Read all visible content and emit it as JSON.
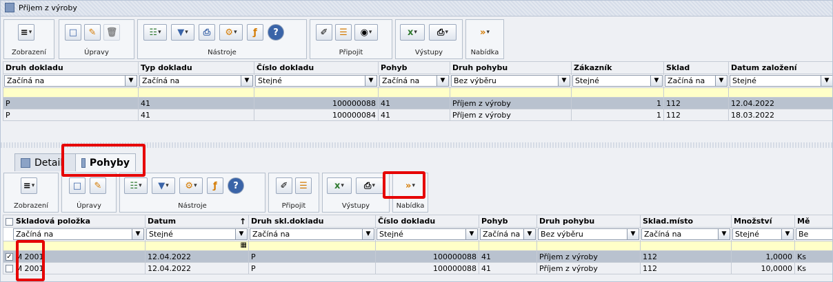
{
  "window": {
    "title": "Příjem z výroby"
  },
  "top_toolbar": {
    "groups": [
      {
        "caption": "Zobrazení"
      },
      {
        "caption": "Úpravy"
      },
      {
        "caption": "Nástroje"
      },
      {
        "caption": "Připojit"
      },
      {
        "caption": "Výstupy"
      },
      {
        "caption": "Nabídka"
      }
    ]
  },
  "top_grid": {
    "columns": [
      "Druh dokladu",
      "Typ dokladu",
      "Číslo dokladu",
      "Pohyb",
      "Druh pohybu",
      "Zákazník",
      "Sklad",
      "Datum založení"
    ],
    "filters": [
      "Začíná na",
      "Začíná na",
      "Stejné",
      "Začíná na",
      "Bez výběru",
      "Stejné",
      "Začíná na",
      "Stejné"
    ],
    "rows": [
      [
        "P",
        "41",
        "100000088",
        "41",
        "Příjem z výroby",
        "1",
        "112",
        "12.04.2022"
      ],
      [
        "P",
        "41",
        "100000084",
        "41",
        "Příjem z výroby",
        "1",
        "112",
        "18.03.2022"
      ]
    ]
  },
  "tabs": {
    "detail": "Detail",
    "pohyby": "Pohyby"
  },
  "bottom_toolbar": {
    "groups": [
      {
        "caption": "Zobrazení"
      },
      {
        "caption": "Úpravy"
      },
      {
        "caption": "Nástroje"
      },
      {
        "caption": "Připojit"
      },
      {
        "caption": "Výstupy"
      },
      {
        "caption": "Nabídka"
      }
    ]
  },
  "bottom_grid": {
    "columns": [
      "Skladová položka",
      "Datum",
      "Druh skl.dokladu",
      "Číslo dokladu",
      "Pohyb",
      "Druh pohybu",
      "Sklad.místo",
      "Množství",
      "Mě"
    ],
    "filters": [
      "Začíná na",
      "Stejné",
      "Začíná na",
      "Stejné",
      "Začíná na",
      "Bez výběru",
      "Začíná na",
      "Stejné",
      "Be"
    ],
    "rows": [
      {
        "checked": "✓",
        "cells": [
          "M 2001",
          "12.04.2022",
          "P",
          "100000088",
          "41",
          "Příjem z výroby",
          "112",
          "1,0000",
          "Ks"
        ]
      },
      {
        "checked": "",
        "cells": [
          "M 2001",
          "12.04.2022",
          "P",
          "100000088",
          "41",
          "Příjem z výroby",
          "112",
          "10,0000",
          "Ks"
        ]
      }
    ]
  },
  "colors": {
    "highlight": "#e60000",
    "selected_row": "#b9c2cf",
    "filter_row": "#ffffc8"
  }
}
